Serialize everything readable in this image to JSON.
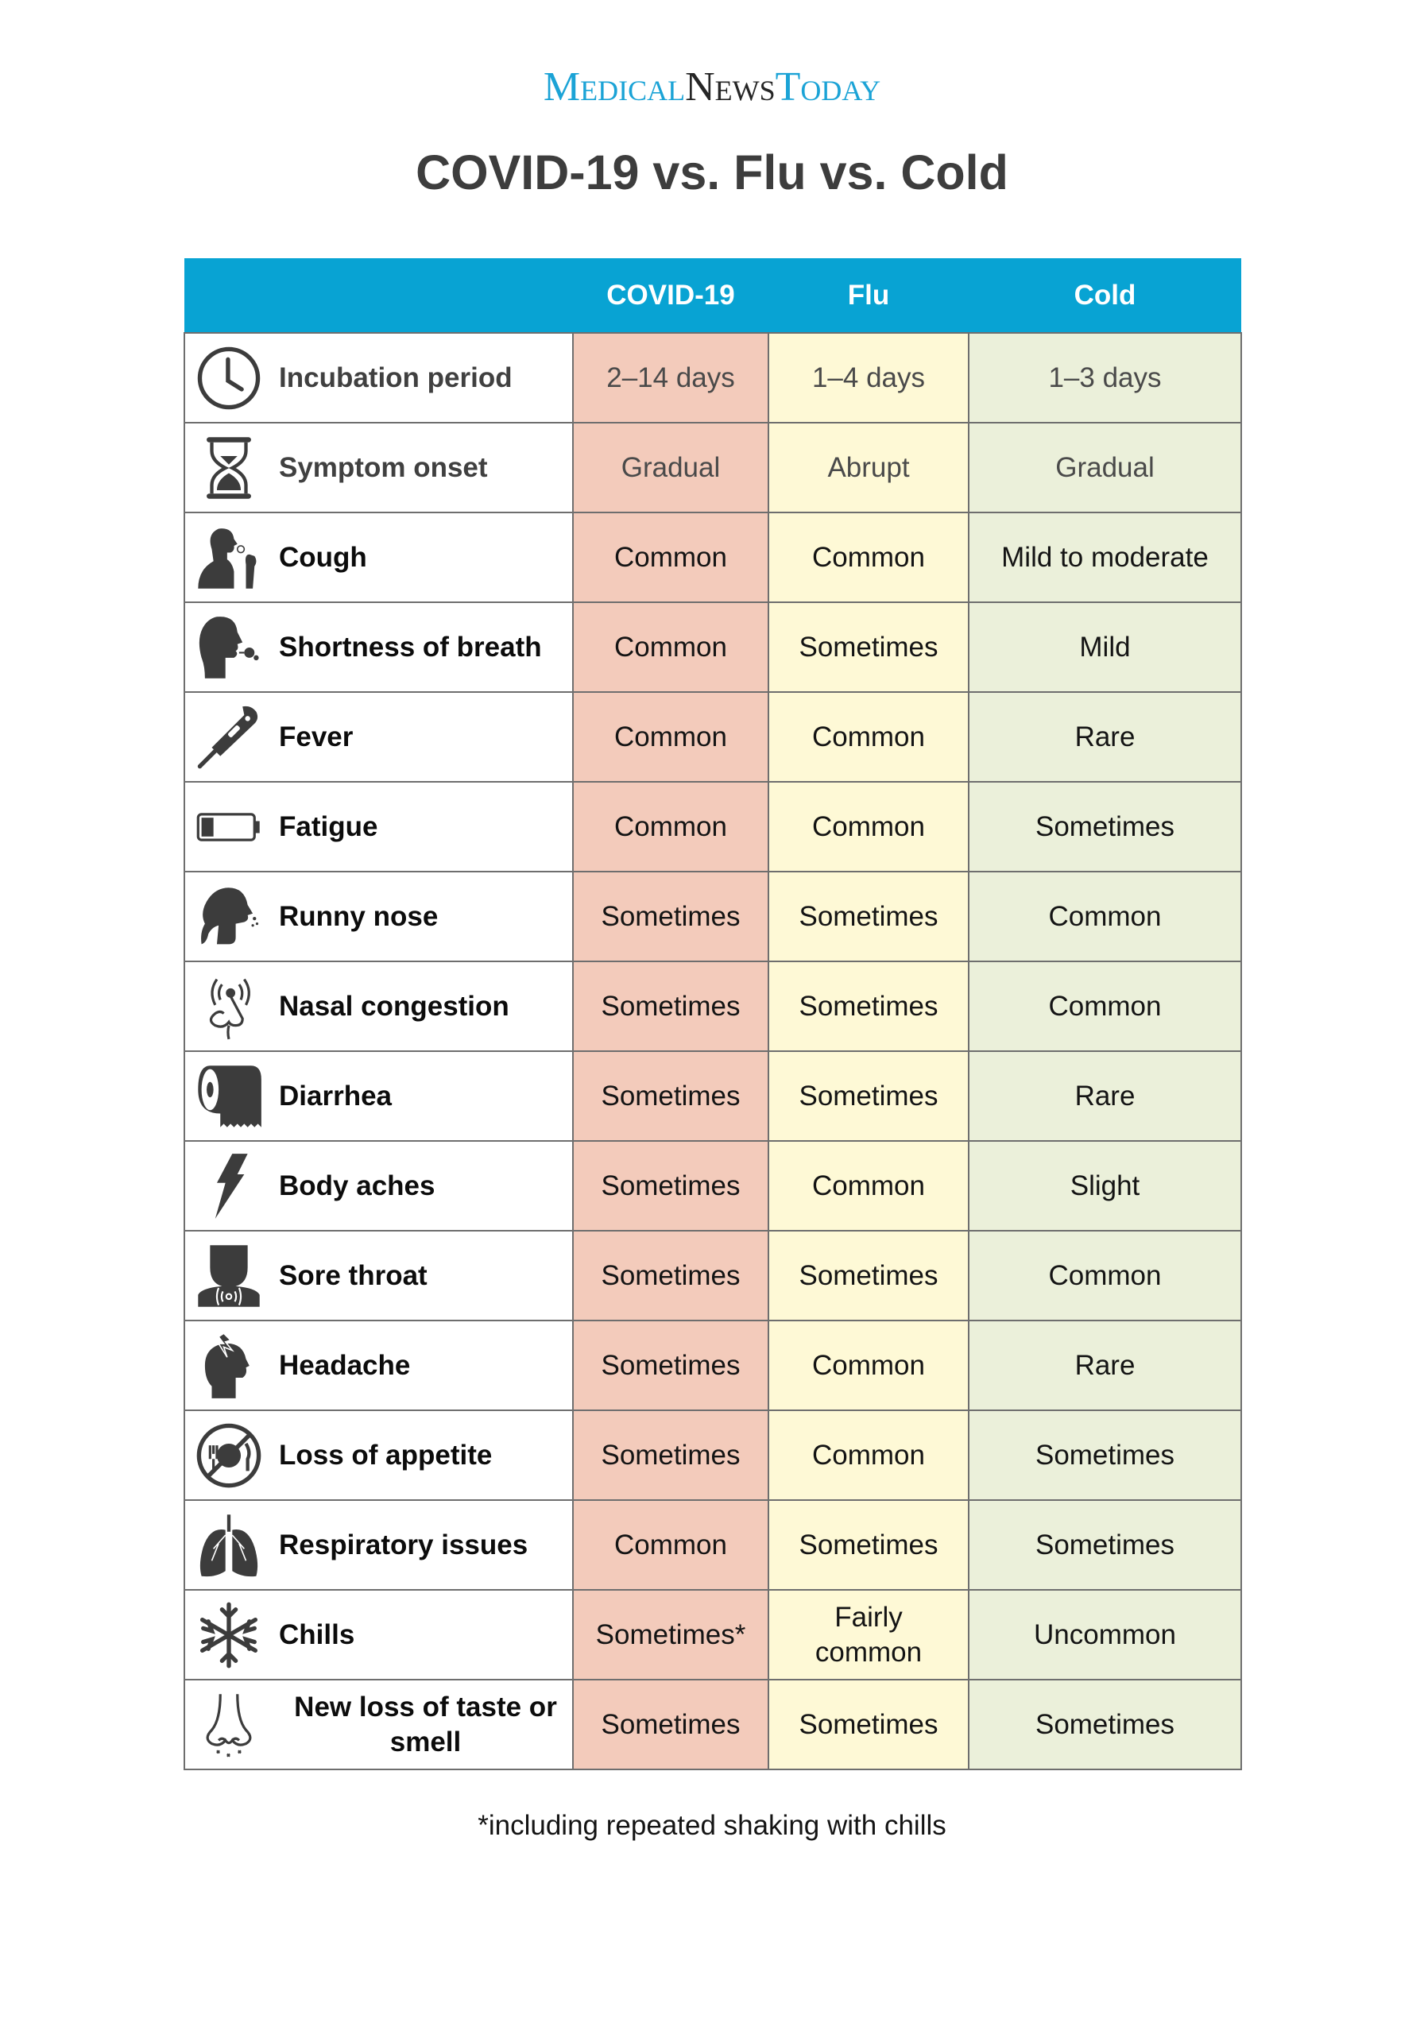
{
  "logo": {
    "part1": "Medical",
    "part2": "News",
    "part3": "Today",
    "colors": {
      "blue": "#1ba3d6",
      "dark": "#262626"
    }
  },
  "title": "COVID-19 vs. Flu vs. Cold",
  "table": {
    "header_color": "#08a3d3",
    "columns": [
      "",
      "COVID-19",
      "Flu",
      "Cold"
    ],
    "column_colors": {
      "covid": "#f3cbbb",
      "flu": "#fef9d6",
      "cold": "#ebf0da"
    },
    "rows": [
      {
        "icon": "clock-icon",
        "label": "Incubation period",
        "covid": "2–14 days",
        "flu": "1–4 days",
        "cold": "1–3 days"
      },
      {
        "icon": "hourglass-icon",
        "label": "Symptom onset",
        "covid": "Gradual",
        "flu": "Abrupt",
        "cold": "Gradual"
      },
      {
        "icon": "coughing-person-icon",
        "label": "Cough",
        "covid": "Common",
        "flu": "Common",
        "cold": "Mild to moderate"
      },
      {
        "icon": "breathing-head-icon",
        "label": "Shortness of breath",
        "covid": "Common",
        "flu": "Sometimes",
        "cold": "Mild"
      },
      {
        "icon": "thermometer-icon",
        "label": "Fever",
        "covid": "Common",
        "flu": "Common",
        "cold": "Rare"
      },
      {
        "icon": "low-battery-icon",
        "label": "Fatigue",
        "covid": "Common",
        "flu": "Common",
        "cold": "Sometimes"
      },
      {
        "icon": "runny-nose-head-icon",
        "label": "Runny nose",
        "covid": "Sometimes",
        "flu": "Sometimes",
        "cold": "Common"
      },
      {
        "icon": "congested-nose-icon",
        "label": "Nasal congestion",
        "covid": "Sometimes",
        "flu": "Sometimes",
        "cold": "Common"
      },
      {
        "icon": "toilet-paper-icon",
        "label": "Diarrhea",
        "covid": "Sometimes",
        "flu": "Sometimes",
        "cold": "Rare"
      },
      {
        "icon": "lightning-bolt-icon",
        "label": "Body aches",
        "covid": "Sometimes",
        "flu": "Common",
        "cold": "Slight"
      },
      {
        "icon": "sore-throat-icon",
        "label": "Sore throat",
        "covid": "Sometimes",
        "flu": "Sometimes",
        "cold": "Common"
      },
      {
        "icon": "headache-icon",
        "label": "Headache",
        "covid": "Sometimes",
        "flu": "Common",
        "cold": "Rare"
      },
      {
        "icon": "no-food-icon",
        "label": "Loss of appetite",
        "covid": "Sometimes",
        "flu": "Common",
        "cold": "Sometimes"
      },
      {
        "icon": "lungs-icon",
        "label": "Respiratory issues",
        "covid": "Common",
        "flu": "Sometimes",
        "cold": "Sometimes"
      },
      {
        "icon": "snowflake-icon",
        "label": "Chills",
        "covid": "Sometimes*",
        "flu": "Fairly common",
        "cold": "Uncommon"
      },
      {
        "icon": "nose-outline-icon",
        "label": "New loss of taste or smell",
        "covid": "Sometimes",
        "flu": "Sometimes",
        "cold": "Sometimes"
      }
    ]
  },
  "footnote": "*including repeated shaking with chills"
}
